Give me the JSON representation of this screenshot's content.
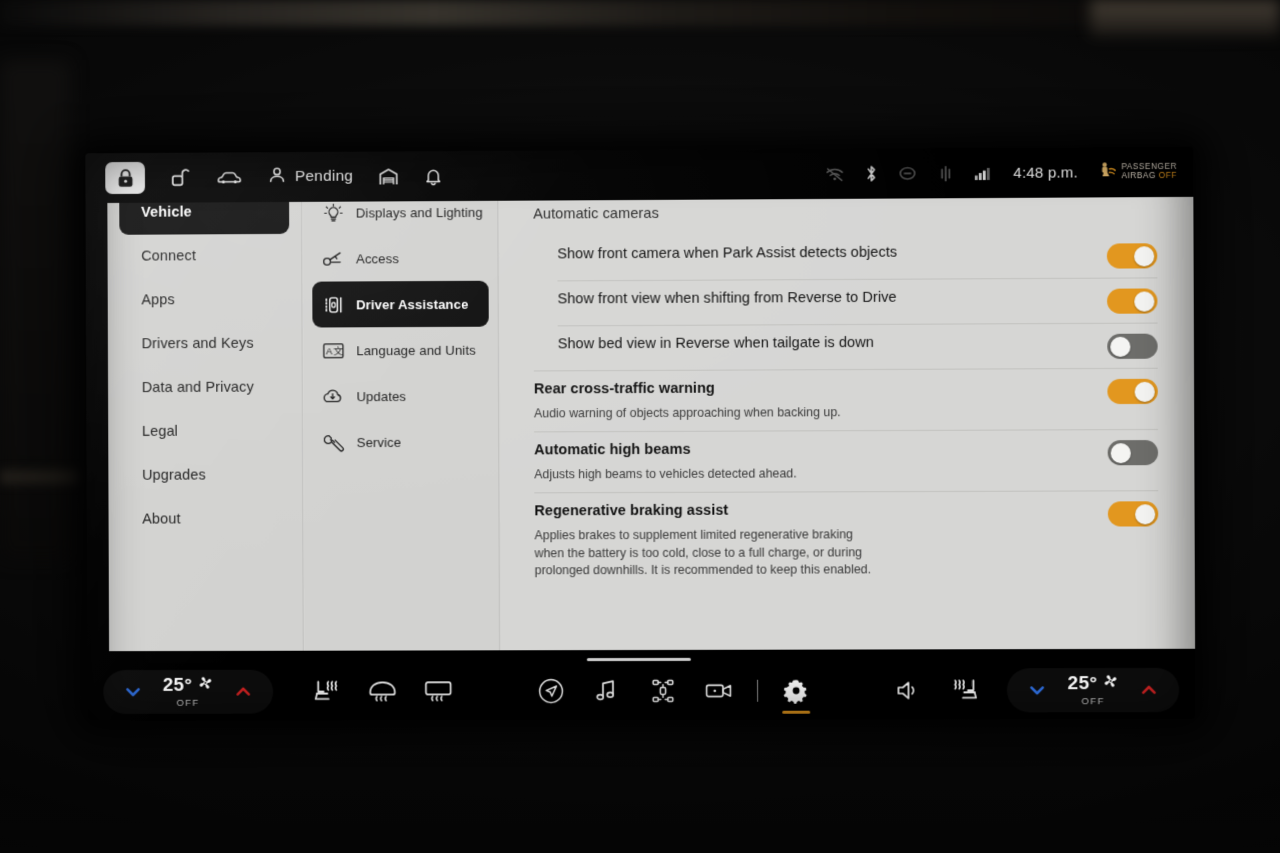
{
  "statusbar": {
    "tabs": [
      {
        "name": "lock-icon",
        "label": "Lock",
        "active": true
      },
      {
        "name": "unlock-icon",
        "label": "Unlock",
        "active": false
      },
      {
        "name": "car-icon",
        "label": "Vehicle",
        "active": false
      }
    ],
    "driver_status": "Pending",
    "right_icons": [
      {
        "name": "wifi-off-icon",
        "dim": true
      },
      {
        "name": "bluetooth-icon",
        "dim": false
      },
      {
        "name": "tire-pressure-icon",
        "dim": true
      },
      {
        "name": "tire-tread-icon",
        "dim": true
      },
      {
        "name": "cellular-signal-icon",
        "dim": false
      }
    ],
    "clock": "4:48 p.m.",
    "airbag_line1": "PASSENGER",
    "airbag_line2": "AIRBAG",
    "airbag_state": "OFF"
  },
  "sidebar": {
    "items": [
      {
        "label": "Vehicle",
        "active": true
      },
      {
        "label": "Connect",
        "active": false
      },
      {
        "label": "Apps",
        "active": false
      },
      {
        "label": "Drivers and Keys",
        "active": false
      },
      {
        "label": "Data and Privacy",
        "active": false
      },
      {
        "label": "Legal",
        "active": false
      },
      {
        "label": "Upgrades",
        "active": false
      },
      {
        "label": "About",
        "active": false
      }
    ]
  },
  "subnav": {
    "items": [
      {
        "label": "Displays and Lighting",
        "icon": "lightbulb-icon",
        "active": false
      },
      {
        "label": "Access",
        "icon": "key-icon",
        "active": false
      },
      {
        "label": "Driver Assistance",
        "icon": "driver-assistance-icon",
        "active": true
      },
      {
        "label": "Language and Units",
        "icon": "language-icon",
        "active": false
      },
      {
        "label": "Updates",
        "icon": "cloud-download-icon",
        "active": false
      },
      {
        "label": "Service",
        "icon": "wrench-icon",
        "active": false
      }
    ]
  },
  "content": {
    "section_title": "Automatic cameras",
    "rows": [
      {
        "label": "Show front camera when Park Assist detects objects",
        "desc": "",
        "toggle": "on",
        "indent": true,
        "major": false
      },
      {
        "label": "Show front view when shifting from Reverse to Drive",
        "desc": "",
        "toggle": "on",
        "indent": true,
        "major": false
      },
      {
        "label": "Show bed view in Reverse when tailgate is down",
        "desc": "",
        "toggle": "off",
        "indent": true,
        "major": false
      },
      {
        "label": "Rear cross-traffic warning",
        "desc": "Audio warning of objects approaching when backing up.",
        "toggle": "on",
        "indent": false,
        "major": true
      },
      {
        "label": "Automatic high beams",
        "desc": "Adjusts high beams to vehicles detected ahead.",
        "toggle": "off",
        "indent": false,
        "major": true
      },
      {
        "label": "Regenerative braking assist",
        "desc": "Applies brakes to supplement limited regenerative braking when the battery is too cold, close to a full charge, or during prolonged downhills. It is recommended to keep this enabled.",
        "toggle": "on",
        "indent": false,
        "major": true
      }
    ]
  },
  "bottombar": {
    "climate_left": {
      "temp": "25°",
      "state": "OFF"
    },
    "climate_right": {
      "temp": "25°",
      "state": "OFF"
    },
    "left_buttons": [
      {
        "name": "driver-seat-heater-icon"
      },
      {
        "name": "front-defrost-icon"
      },
      {
        "name": "rear-defrost-icon"
      }
    ],
    "center_buttons": [
      {
        "name": "navigation-icon",
        "active": false
      },
      {
        "name": "media-icon",
        "active": false
      },
      {
        "name": "offroad-icon",
        "active": false
      },
      {
        "name": "dashcam-icon",
        "active": false
      },
      {
        "name": "settings-gear-icon",
        "active": true
      }
    ],
    "right_buttons": [
      {
        "name": "volume-icon"
      },
      {
        "name": "passenger-seat-heater-icon"
      }
    ]
  },
  "colors": {
    "accent_orange": "#e2971f",
    "toggle_off": "#6d6d6a",
    "panel_bg": "#d4d4d2",
    "active_nav_bg": "#101010",
    "chevron_down": "#2f6fe0",
    "chevron_up": "#cc2222"
  }
}
